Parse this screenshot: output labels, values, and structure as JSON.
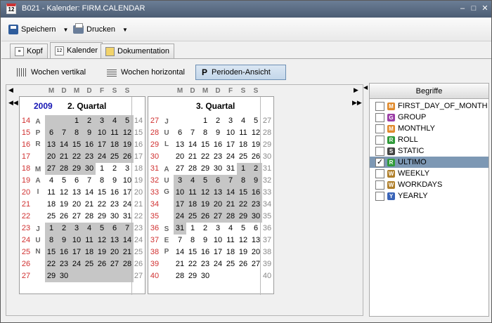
{
  "window": {
    "title": "B021 - Kalender: FIRM.CALENDAR",
    "icon_text": "12"
  },
  "toolbar": {
    "save_label": "Speichern",
    "print_label": "Drucken"
  },
  "tabs": [
    {
      "label": "Kopf"
    },
    {
      "label": "Kalender"
    },
    {
      "label": "Dokumentation"
    }
  ],
  "views": [
    {
      "label": "Wochen vertikal"
    },
    {
      "label": "Wochen horizontal"
    },
    {
      "label": "Perioden-Ansicht"
    }
  ],
  "calendar": {
    "year": "2009",
    "day_headers": [
      "M",
      "D",
      "M",
      "D",
      "F",
      "S",
      "S"
    ],
    "q2": {
      "title": "2. Quartal",
      "weeks_left": [
        "14",
        "15",
        "16",
        "17",
        "18",
        "19",
        "20",
        "21",
        "22",
        "23",
        "24",
        "25",
        "26",
        "27"
      ],
      "weeks_right": [
        "14",
        "15",
        "16",
        "17",
        "18",
        "19",
        "20",
        "21",
        "22",
        "23",
        "24",
        "25",
        "26",
        "27"
      ],
      "months": [
        {
          "letters": [
            "A",
            "P",
            "R"
          ]
        },
        {
          "letters": [
            "M",
            "A",
            "I"
          ]
        },
        {
          "letters": [
            "J",
            "U",
            "N"
          ]
        }
      ],
      "rows": [
        [
          "",
          "",
          "1",
          "2",
          "3",
          "4",
          "5"
        ],
        [
          "6",
          "7",
          "8",
          "9",
          "10",
          "11",
          "12"
        ],
        [
          "13",
          "14",
          "15",
          "16",
          "17",
          "18",
          "19"
        ],
        [
          "20",
          "21",
          "22",
          "23",
          "24",
          "25",
          "26"
        ],
        [
          "27",
          "28",
          "29",
          "30",
          "1",
          "2",
          "3"
        ],
        [
          "4",
          "5",
          "6",
          "7",
          "8",
          "9",
          "10"
        ],
        [
          "11",
          "12",
          "13",
          "14",
          "15",
          "16",
          "17"
        ],
        [
          "18",
          "19",
          "20",
          "21",
          "22",
          "23",
          "24"
        ],
        [
          "25",
          "26",
          "27",
          "28",
          "29",
          "30",
          "31"
        ],
        [
          "1",
          "2",
          "3",
          "4",
          "5",
          "6",
          "7"
        ],
        [
          "8",
          "9",
          "10",
          "11",
          "12",
          "13",
          "14"
        ],
        [
          "15",
          "16",
          "17",
          "18",
          "19",
          "20",
          "21"
        ],
        [
          "22",
          "23",
          "24",
          "25",
          "26",
          "27",
          "28"
        ],
        [
          "29",
          "30",
          "",
          "",
          "",
          "",
          ""
        ]
      ]
    },
    "q3": {
      "title": "3. Quartal",
      "weeks_left": [
        "27",
        "28",
        "29",
        "30",
        "31",
        "32",
        "33",
        "34",
        "35",
        "36",
        "37",
        "38",
        "39",
        "40"
      ],
      "weeks_right": [
        "27",
        "28",
        "29",
        "30",
        "31",
        "32",
        "33",
        "34",
        "35",
        "36",
        "37",
        "38",
        "39",
        "40"
      ],
      "months": [
        {
          "letters": [
            "J",
            "U",
            "L"
          ]
        },
        {
          "letters": [
            "A",
            "U",
            "G"
          ]
        },
        {
          "letters": [
            "S",
            "E",
            "P"
          ]
        }
      ],
      "rows": [
        [
          "",
          "",
          "1",
          "2",
          "3",
          "4",
          "5"
        ],
        [
          "6",
          "7",
          "8",
          "9",
          "10",
          "11",
          "12"
        ],
        [
          "13",
          "14",
          "15",
          "16",
          "17",
          "18",
          "19"
        ],
        [
          "20",
          "21",
          "22",
          "23",
          "24",
          "25",
          "26"
        ],
        [
          "27",
          "28",
          "29",
          "30",
          "31",
          "1",
          "2"
        ],
        [
          "3",
          "4",
          "5",
          "6",
          "7",
          "8",
          "9"
        ],
        [
          "10",
          "11",
          "12",
          "13",
          "14",
          "15",
          "16"
        ],
        [
          "17",
          "18",
          "19",
          "20",
          "21",
          "22",
          "23"
        ],
        [
          "24",
          "25",
          "26",
          "27",
          "28",
          "29",
          "30"
        ],
        [
          "31",
          "1",
          "2",
          "3",
          "4",
          "5",
          "6"
        ],
        [
          "7",
          "8",
          "9",
          "10",
          "11",
          "12",
          "13"
        ],
        [
          "14",
          "15",
          "16",
          "17",
          "18",
          "19",
          "20"
        ],
        [
          "21",
          "22",
          "23",
          "24",
          "25",
          "26",
          "27"
        ],
        [
          "28",
          "29",
          "30",
          "",
          "",
          "",
          ""
        ]
      ]
    }
  },
  "terms_panel": {
    "header": "Begriffe",
    "items": [
      {
        "label": "FIRST_DAY_OF_MONTH",
        "badge": "M",
        "color": "#e08a2c",
        "checked": false
      },
      {
        "label": "GROUP",
        "badge": "G",
        "color": "#9b3ea6",
        "checked": false
      },
      {
        "label": "MONTHLY",
        "badge": "M",
        "color": "#e08a2c",
        "checked": false
      },
      {
        "label": "ROLL",
        "badge": "R",
        "color": "#2f9a3a",
        "checked": false
      },
      {
        "label": "STATIC",
        "badge": "S",
        "color": "#444444",
        "checked": false
      },
      {
        "label": "ULTIMO",
        "badge": "R",
        "color": "#2f9a3a",
        "checked": true
      },
      {
        "label": "WEEKLY",
        "badge": "W",
        "color": "#b0802c",
        "checked": false
      },
      {
        "label": "WORKDAYS",
        "badge": "W",
        "color": "#b0802c",
        "checked": false
      },
      {
        "label": "YEARLY",
        "badge": "Y",
        "color": "#3a64b8",
        "checked": false
      }
    ]
  }
}
